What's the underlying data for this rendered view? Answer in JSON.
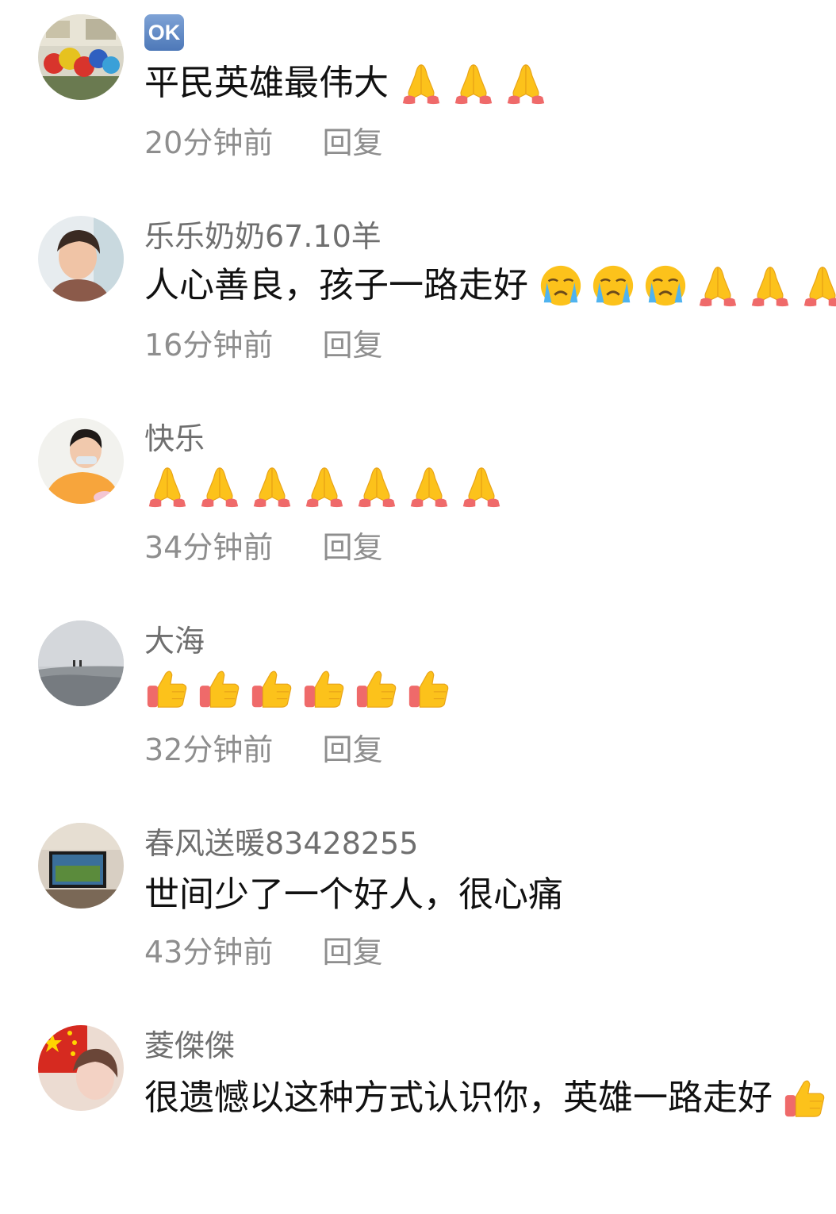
{
  "comments": [
    {
      "user": "",
      "badge": "OK",
      "text": "平民英雄最伟大",
      "emojis": [
        "pray-emoji",
        "pray-emoji",
        "pray-emoji"
      ],
      "time": "20分钟前",
      "reply": "回复"
    },
    {
      "user": "乐乐奶奶67.10羊",
      "text": "人心善良，孩子一路走好",
      "emojis": [
        "crying-emoji",
        "crying-emoji",
        "crying-emoji",
        "pray-emoji",
        "pray-emoji",
        "pray-emoji"
      ],
      "time": "16分钟前",
      "reply": "回复"
    },
    {
      "user": "快乐",
      "text": "",
      "emojis": [
        "pray-emoji",
        "pray-emoji",
        "pray-emoji",
        "pray-emoji",
        "pray-emoji",
        "pray-emoji",
        "pray-emoji"
      ],
      "time": "34分钟前",
      "reply": "回复"
    },
    {
      "user": "大海",
      "text": "",
      "emojis": [
        "thumbs-up-emoji",
        "thumbs-up-emoji",
        "thumbs-up-emoji",
        "thumbs-up-emoji",
        "thumbs-up-emoji",
        "thumbs-up-emoji"
      ],
      "time": "32分钟前",
      "reply": "回复"
    },
    {
      "user": "春风送暖83428255",
      "text": "世间少了一个好人，很心痛",
      "emojis": [],
      "time": "43分钟前",
      "reply": "回复"
    },
    {
      "user": "菱傑傑",
      "text": "很遗憾以这种方式认识你，英雄一路走好",
      "emojis": [
        "thumbs-up-emoji"
      ],
      "time": "",
      "reply": ""
    }
  ],
  "colors": {
    "username": "#6f6f6f",
    "content": "#111111",
    "meta": "#8e8e8e",
    "background": "#ffffff"
  }
}
